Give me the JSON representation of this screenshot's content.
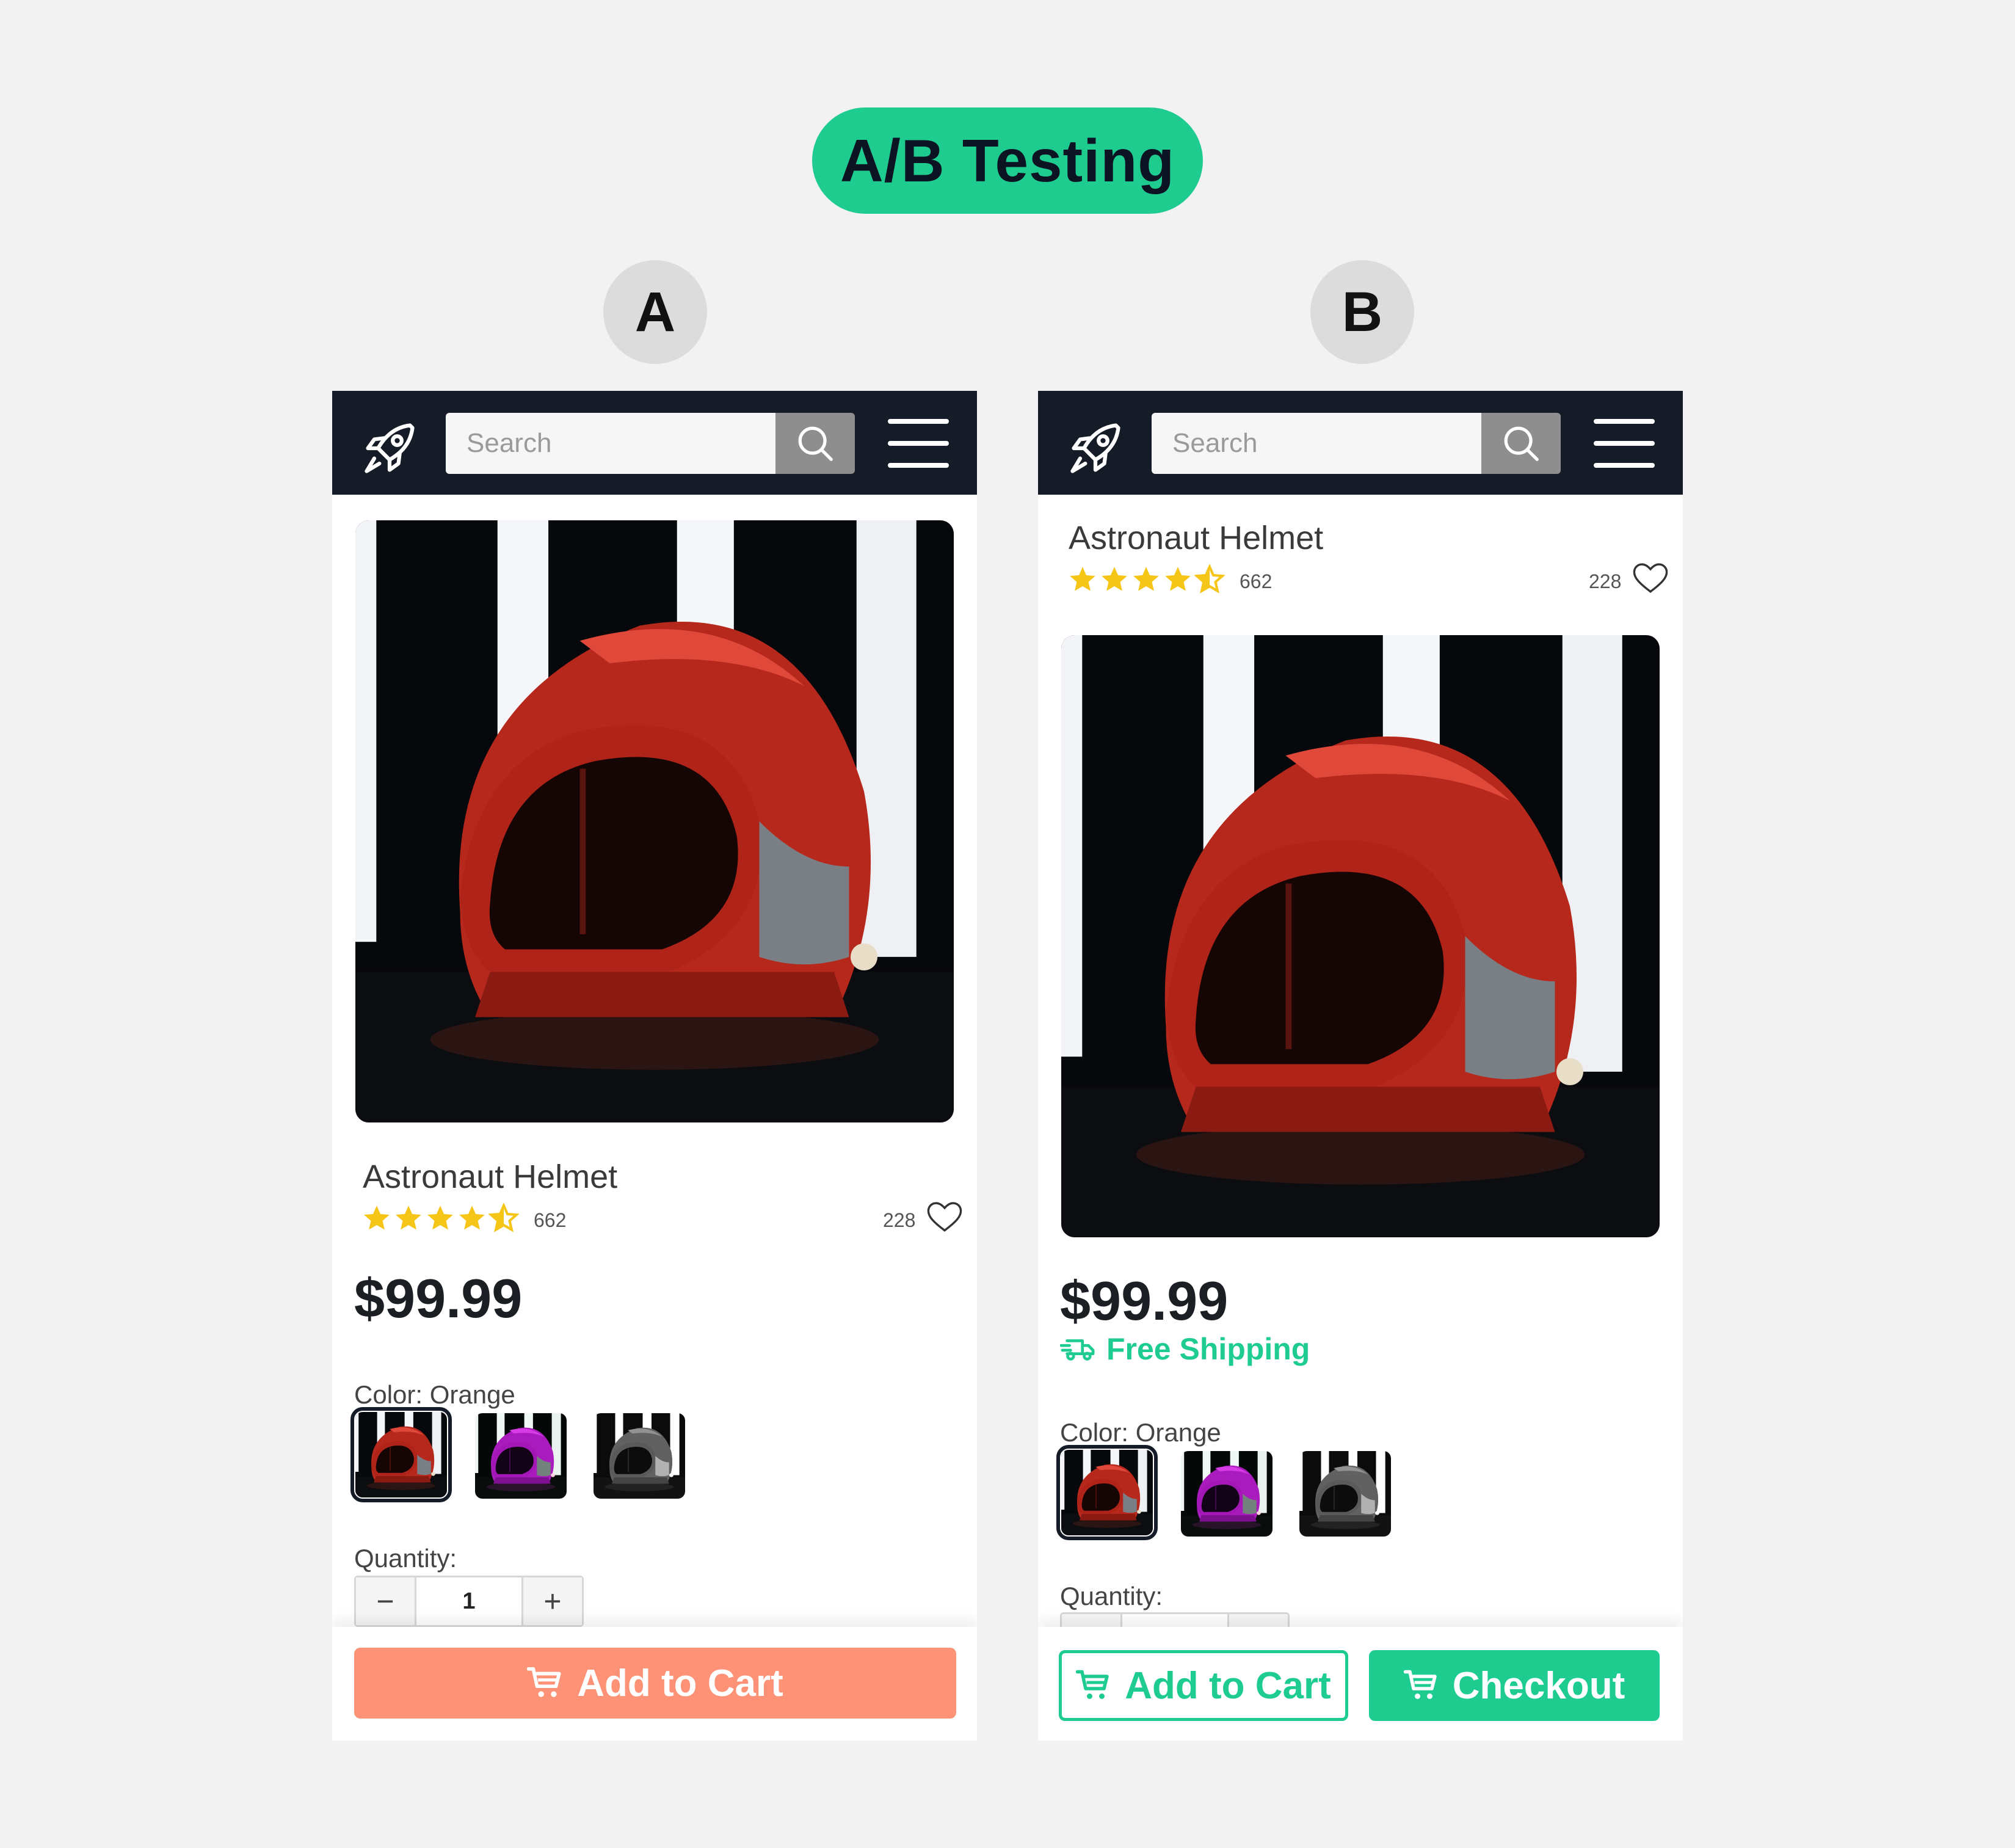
{
  "title": "A/B Testing",
  "variants": [
    {
      "label": "A",
      "search_placeholder": "Search",
      "product_name": "Astronaut Helmet",
      "rating_stars": 4.5,
      "rating_count": "662",
      "favorites_count": "228",
      "price": "$99.99",
      "color_label": "Color: Orange",
      "quantity_label": "Quantity:",
      "quantity_value": "1",
      "stepper_minus": "−",
      "stepper_plus": "+",
      "cta_primary": "Add to Cart"
    },
    {
      "label": "B",
      "search_placeholder": "Search",
      "product_name": "Astronaut Helmet",
      "rating_stars": 4.5,
      "rating_count": "662",
      "favorites_count": "228",
      "price": "$99.99",
      "shipping": "Free Shipping",
      "color_label": "Color: Orange",
      "quantity_label": "Quantity:",
      "cta_secondary": "Add to Cart",
      "cta_primary": "Checkout"
    }
  ],
  "colors": {
    "accent_green": "#1fcc8f",
    "cta_coral": "#fd9277",
    "navbar": "#161b28",
    "star": "#f5c518"
  },
  "swatch_options": [
    "orange",
    "purple",
    "silver"
  ],
  "icons": [
    "rocket-icon",
    "search-icon",
    "menu-icon",
    "star-icon",
    "heart-icon",
    "truck-icon",
    "cart-icon"
  ]
}
